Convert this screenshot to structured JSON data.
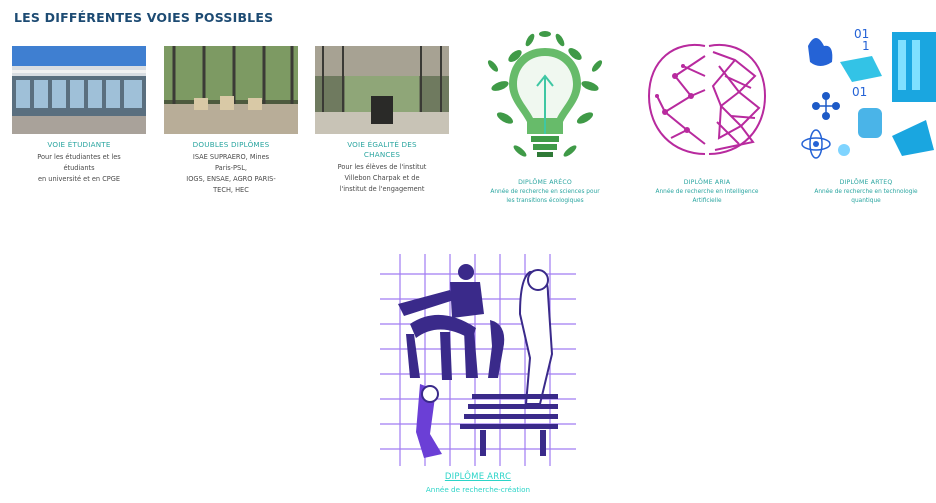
{
  "section_title": "LES DIFFÉRENTES VOIES POSSIBLES",
  "cards": [
    {
      "label": "VOIE ÉTUDIANTE",
      "desc": "Pour les étudiantes et les\nétudiants\nen université et en CPGE"
    },
    {
      "label": "DOUBLES DIPLÔMES",
      "desc": "ISAE SUPRAERO, Mines\nParis-PSL,\nIOGS, ENSAE, AGRO PARIS-\nTECH, HEC"
    },
    {
      "label": "VOIE ÉGALITÉ DES\nCHANCES",
      "desc": "Pour les élèves de l'institut\nVillebon Charpak et de\nl'institut de l'engagement"
    },
    {
      "label": "DIPLÔME ARéco",
      "desc": "Année de recherche en sciences pour\nles transitions écologiques"
    },
    {
      "label": "DIPLÔME ARIA",
      "desc": "Année de recherche en Intelligence\nArtificielle"
    },
    {
      "label": "DIPLÔME ARTeQ",
      "desc": "Année de recherche en technologie\nquantique"
    }
  ],
  "feature": {
    "label": "DIPLÔME ARRC",
    "desc": "Année de recherche-création"
  },
  "colors": {
    "title": "#1d4b73",
    "teal": "#2aa5a0",
    "green": "#3f9a47",
    "magenta": "#b82a9e",
    "blue": "#1aa6e0",
    "purple": "#6b3fd6"
  }
}
